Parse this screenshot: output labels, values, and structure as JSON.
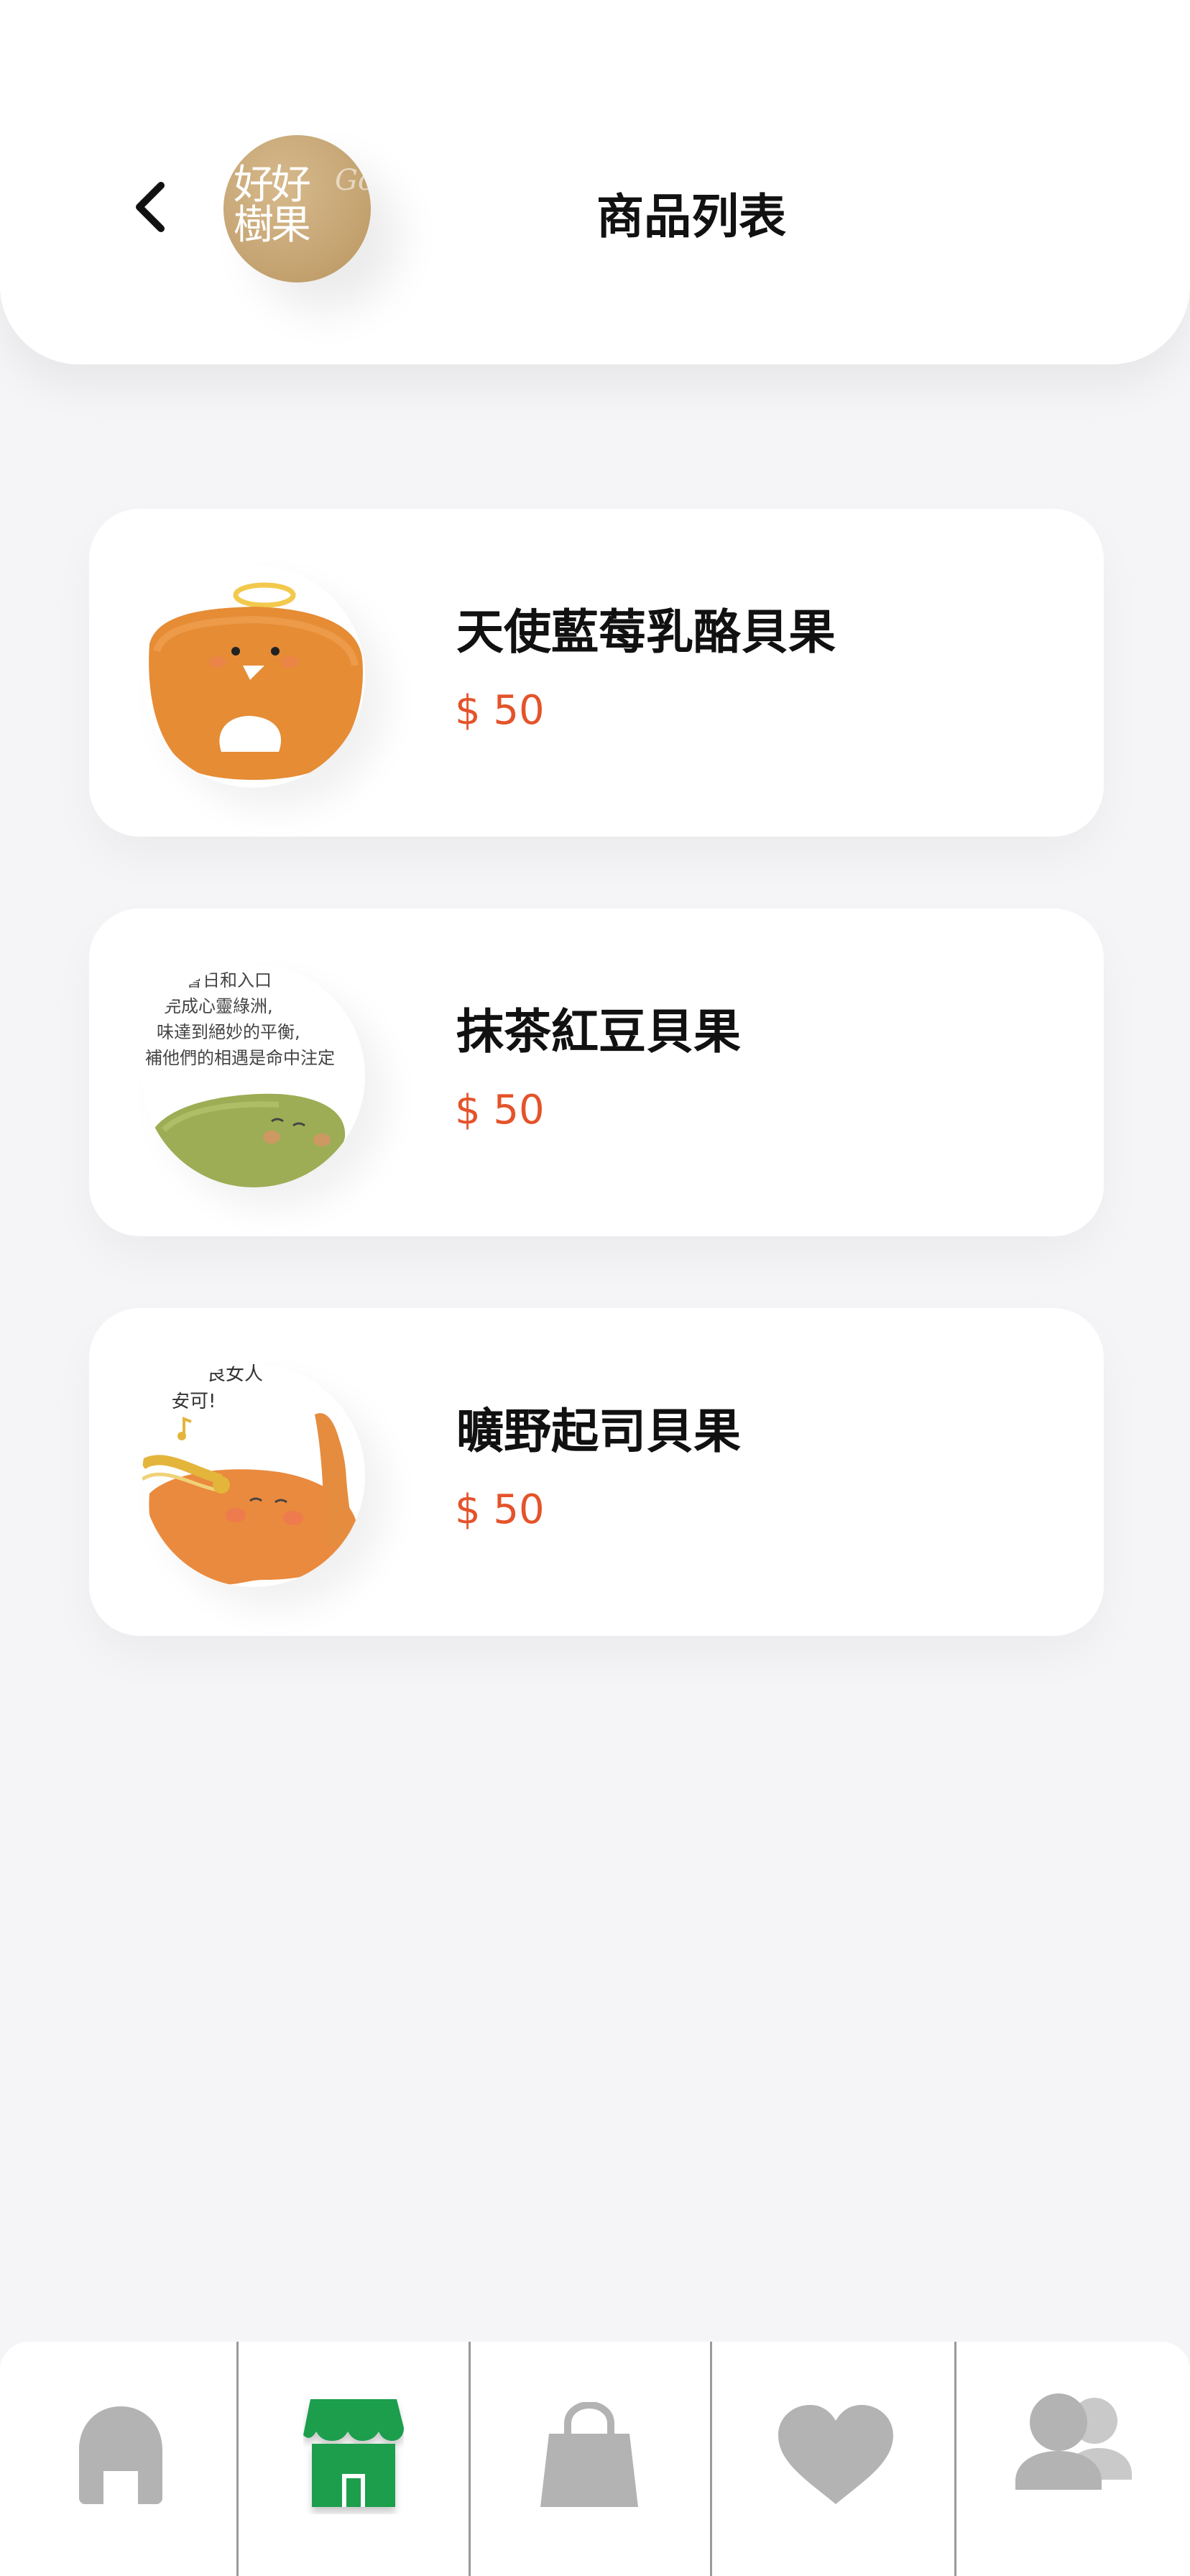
{
  "header": {
    "title": "商品列表",
    "logo": {
      "line1": "好好",
      "line2": "樹果",
      "cursive": "Go"
    },
    "back_icon": "chevron-left-icon"
  },
  "products": [
    {
      "name": "天使藍莓乳酪貝果",
      "price": "$ 50",
      "image": "angel-bagel"
    },
    {
      "name": "抹茶紅豆貝果",
      "price": "$ 50",
      "image": "matcha-bagel"
    },
    {
      "name": "曠野起司貝果",
      "price": "$ 50",
      "image": "cheese-bagel"
    }
  ],
  "bottom_nav": {
    "items": [
      {
        "id": "home",
        "icon": "home-icon",
        "active": false
      },
      {
        "id": "store",
        "icon": "store-icon",
        "active": true
      },
      {
        "id": "bag",
        "icon": "shopping-bag-icon",
        "active": false
      },
      {
        "id": "favorites",
        "icon": "heart-icon",
        "active": false
      },
      {
        "id": "members",
        "icon": "users-icon",
        "active": false
      }
    ],
    "active_color": "#1e9e4e",
    "inactive_color": "#b3b3b3"
  },
  "colors": {
    "price": "#e4532a",
    "background": "#f5f5f7"
  },
  "thumb_text": {
    "matcha": [
      "會日和入口",
      "完成心靈綠洲,",
      "味達到絕妙的平衡,",
      "補他們的相遇是命中注定"
    ],
    "cheese": [
      "良女人",
      "安可!"
    ]
  }
}
